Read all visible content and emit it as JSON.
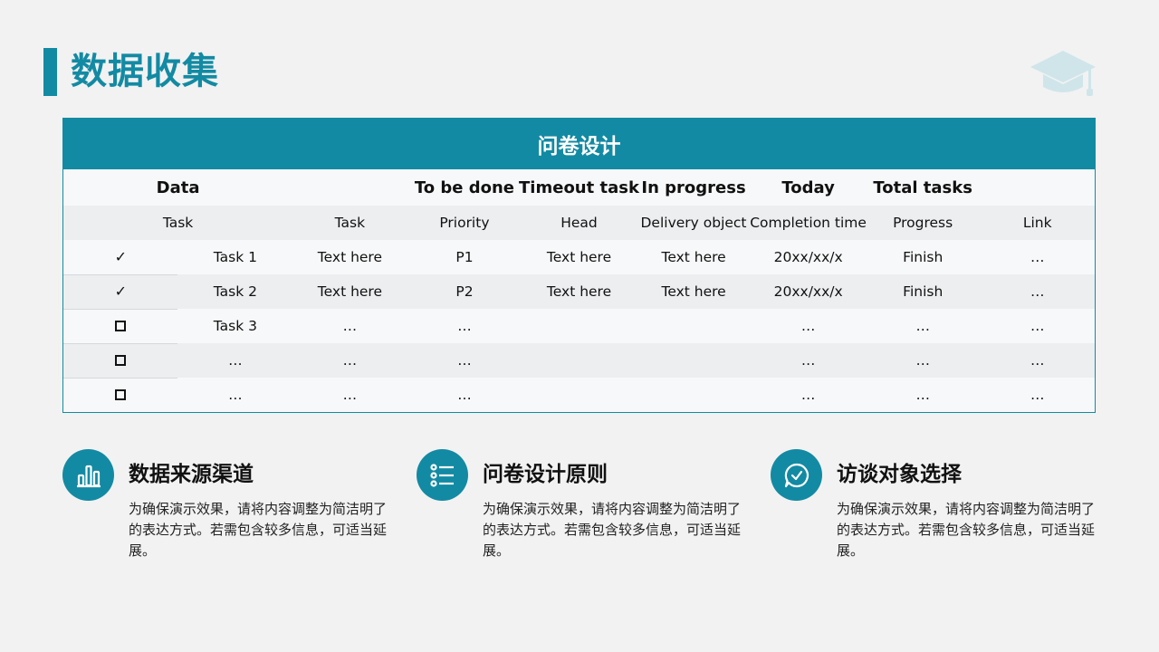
{
  "header": {
    "title": "数据收集",
    "logo_icon": "graduation-cap-icon"
  },
  "table": {
    "title": "问卷设计",
    "header_row": [
      "Data",
      "To be done",
      "Timeout task",
      "In progress",
      "Today",
      "Total tasks"
    ],
    "sub_row": [
      "Task",
      "Task",
      "Priority",
      "Head",
      "Delivery object",
      "Completion time",
      "Progress",
      "Link"
    ],
    "rows": [
      {
        "status": "checked",
        "cells": [
          "Task 1",
          "Text here",
          "P1",
          "Text here",
          "Text here",
          "20xx/xx/x",
          "Finish",
          "…"
        ]
      },
      {
        "status": "checked",
        "cells": [
          "Task 2",
          "Text here",
          "P2",
          "Text here",
          "Text here",
          "20xx/xx/x",
          "Finish",
          "…"
        ]
      },
      {
        "status": "unchecked",
        "cells": [
          "Task 3",
          "…",
          "…",
          "",
          "",
          "…",
          "…",
          "…"
        ]
      },
      {
        "status": "unchecked",
        "cells": [
          "…",
          "…",
          "…",
          "",
          "",
          "…",
          "…",
          "…"
        ]
      },
      {
        "status": "unchecked",
        "cells": [
          "…",
          "…",
          "…",
          "",
          "",
          "…",
          "…",
          "…"
        ]
      }
    ],
    "check_glyph": "✓"
  },
  "features": [
    {
      "icon": "bar-chart-icon",
      "title": "数据来源渠道",
      "desc": "为确保演示效果，请将内容调整为简洁明了的表达方式。若需包含较多信息，可适当延展。"
    },
    {
      "icon": "list-icon",
      "title": "问卷设计原则",
      "desc": "为确保演示效果，请将内容调整为简洁明了的表达方式。若需包含较多信息，可适当延展。"
    },
    {
      "icon": "chat-check-icon",
      "title": "访谈对象选择",
      "desc": "为确保演示效果，请将内容调整为简洁明了的表达方式。若需包含较多信息，可适当延展。"
    }
  ],
  "colors": {
    "accent": "#138aa3",
    "logo": "#cfe5ea",
    "background": "#f2f2f2"
  }
}
